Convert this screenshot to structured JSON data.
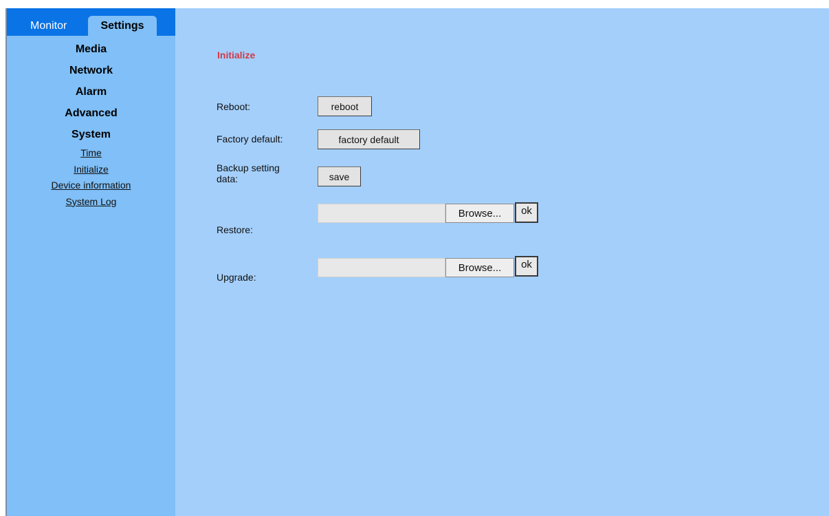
{
  "tabs": {
    "monitor": "Monitor",
    "settings": "Settings"
  },
  "menu": {
    "sections": [
      "Media",
      "Network",
      "Alarm",
      "Advanced",
      "System"
    ],
    "system_items": [
      "Time",
      "Initialize",
      "Device information",
      "System Log"
    ]
  },
  "page": {
    "title": "Initialize"
  },
  "rows": {
    "reboot": {
      "label": "Reboot:",
      "button": "reboot"
    },
    "factory": {
      "label": "Factory default:",
      "button": "factory default"
    },
    "backup": {
      "label": "Backup setting\ndata:",
      "label_line1": "Backup setting",
      "label_line2": "data:",
      "button": "save"
    },
    "restore": {
      "label": "Restore:",
      "file_value": "",
      "browse": "Browse...",
      "ok": "ok"
    },
    "upgrade": {
      "label": "Upgrade:",
      "file_value": "",
      "browse": "Browse...",
      "ok": "ok"
    }
  },
  "colors": {
    "background": "#a4cffb",
    "sidebar": "#80bff7",
    "tab_bar": "#0a73e6",
    "title": "#d23a46"
  }
}
